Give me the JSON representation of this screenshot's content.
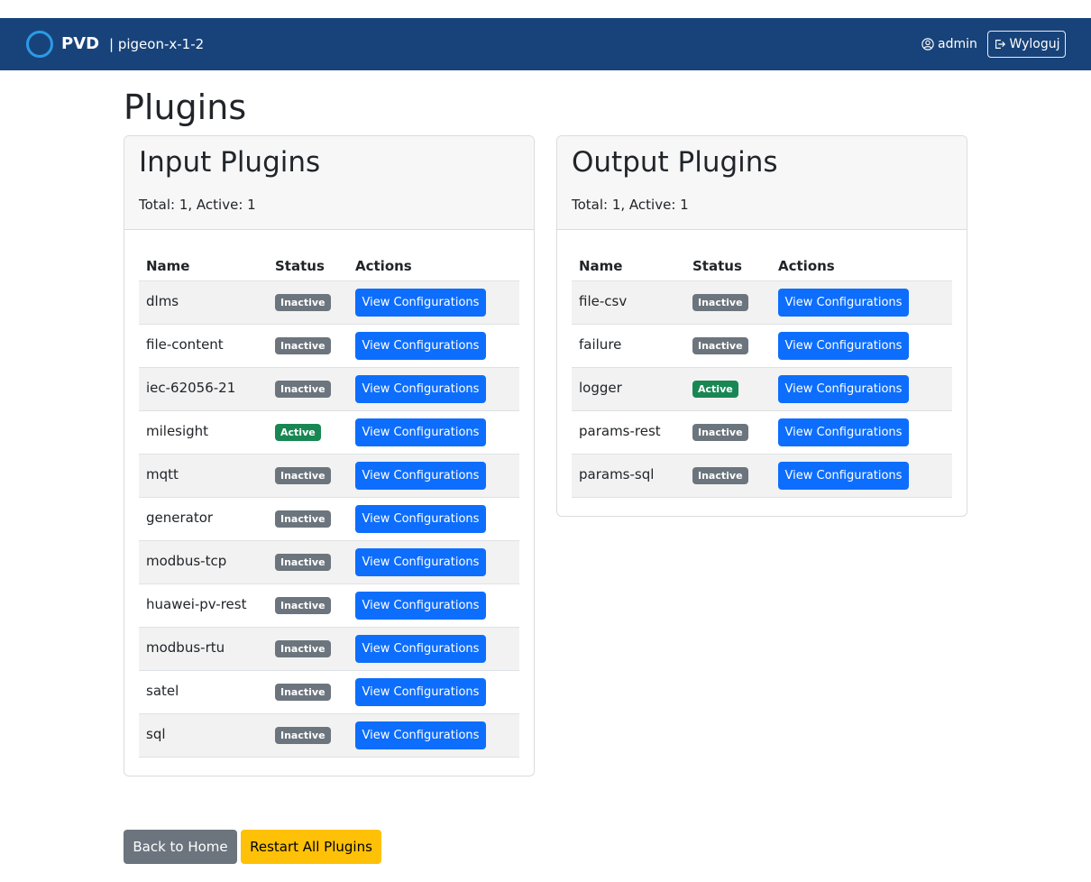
{
  "navbar": {
    "brand": "PVD",
    "host": "| pigeon-x-1-2",
    "user": "admin",
    "logout_label": "Wyloguj"
  },
  "page": {
    "title": "Plugins"
  },
  "columns": {
    "name": "Name",
    "status": "Status",
    "actions": "Actions"
  },
  "input_plugins": {
    "title": "Input Plugins",
    "summary": "Total: 1, Active: 1",
    "rows": [
      {
        "name": "dlms",
        "status": "Inactive",
        "action": "View Configurations"
      },
      {
        "name": "file-content",
        "status": "Inactive",
        "action": "View Configurations"
      },
      {
        "name": "iec-62056-21",
        "status": "Inactive",
        "action": "View Configurations"
      },
      {
        "name": "milesight",
        "status": "Active",
        "action": "View Configurations"
      },
      {
        "name": "mqtt",
        "status": "Inactive",
        "action": "View Configurations"
      },
      {
        "name": "generator",
        "status": "Inactive",
        "action": "View Configurations"
      },
      {
        "name": "modbus-tcp",
        "status": "Inactive",
        "action": "View Configurations"
      },
      {
        "name": "huawei-pv-rest",
        "status": "Inactive",
        "action": "View Configurations"
      },
      {
        "name": "modbus-rtu",
        "status": "Inactive",
        "action": "View Configurations"
      },
      {
        "name": "satel",
        "status": "Inactive",
        "action": "View Configurations"
      },
      {
        "name": "sql",
        "status": "Inactive",
        "action": "View Configurations"
      }
    ]
  },
  "output_plugins": {
    "title": "Output Plugins",
    "summary": "Total: 1, Active: 1",
    "rows": [
      {
        "name": "file-csv",
        "status": "Inactive",
        "action": "View Configurations"
      },
      {
        "name": "failure",
        "status": "Inactive",
        "action": "View Configurations"
      },
      {
        "name": "logger",
        "status": "Active",
        "action": "View Configurations"
      },
      {
        "name": "params-rest",
        "status": "Inactive",
        "action": "View Configurations"
      },
      {
        "name": "params-sql",
        "status": "Inactive",
        "action": "View Configurations"
      }
    ]
  },
  "footer": {
    "back_label": "Back to Home",
    "restart_label": "Restart All Plugins"
  },
  "colors": {
    "navbar": "#18437a",
    "primary": "#0d6efd",
    "active": "#198754",
    "inactive": "#6c757d",
    "warning": "#ffc107"
  }
}
